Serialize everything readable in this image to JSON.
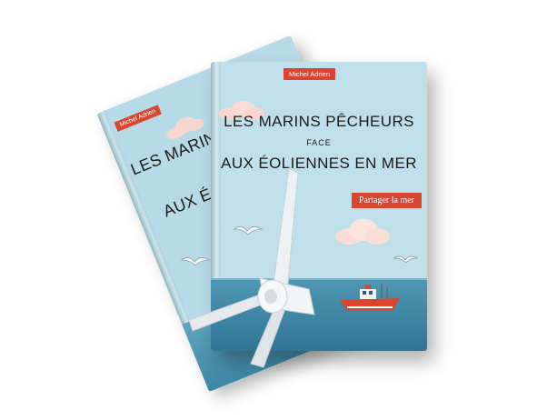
{
  "books": {
    "back": {
      "author": "Michel Adrien",
      "title_line1": "LES MARINS",
      "title_line2": "AUX ÉOLI"
    },
    "front": {
      "author": "Michel Adrien",
      "title_line1": "LES MARINS PÊCHEURS",
      "title_connector": "FACE",
      "title_line2": "AUX ÉOLIENNES EN MER",
      "subtitle": "Partager la mer"
    }
  },
  "colors": {
    "cover_sky": "#bfe0ea",
    "sea": "#3f86a5",
    "badge_red": "#d9452f",
    "title_text": "#1a1a1a",
    "turbine_white": "#eef1f3"
  },
  "icons": [
    "cloud-icon",
    "seagull-icon",
    "wind-turbine-icon",
    "fishing-boat-icon"
  ]
}
